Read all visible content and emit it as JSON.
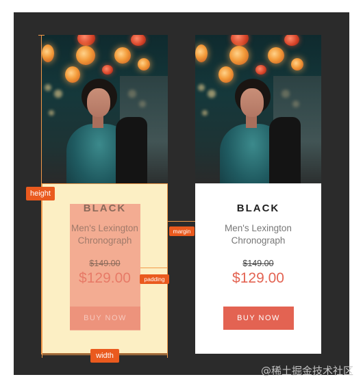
{
  "cards": [
    {
      "brand": "BLACK",
      "name_line1": "Men's Lexington",
      "name_line2": "Chronograph",
      "old_price": "$149.00",
      "price": "$129.00",
      "button_label": "BUY NOW"
    },
    {
      "brand": "BLACK",
      "name_line1": "Men's Lexington",
      "name_line2": "Chronograph",
      "old_price": "$149.00",
      "price": "$129.00",
      "button_label": "BUY NOW"
    }
  ],
  "annotations": {
    "height": "height",
    "width": "width",
    "margin": "margin",
    "padding": "padding"
  },
  "colors": {
    "accent": "#e36352",
    "tag": "#ea5a1e",
    "content_box": "#fcefc4",
    "padding_box": "#f0927e",
    "frame": "#2b2b2b"
  },
  "watermark": "@稀土掘金技术社区"
}
